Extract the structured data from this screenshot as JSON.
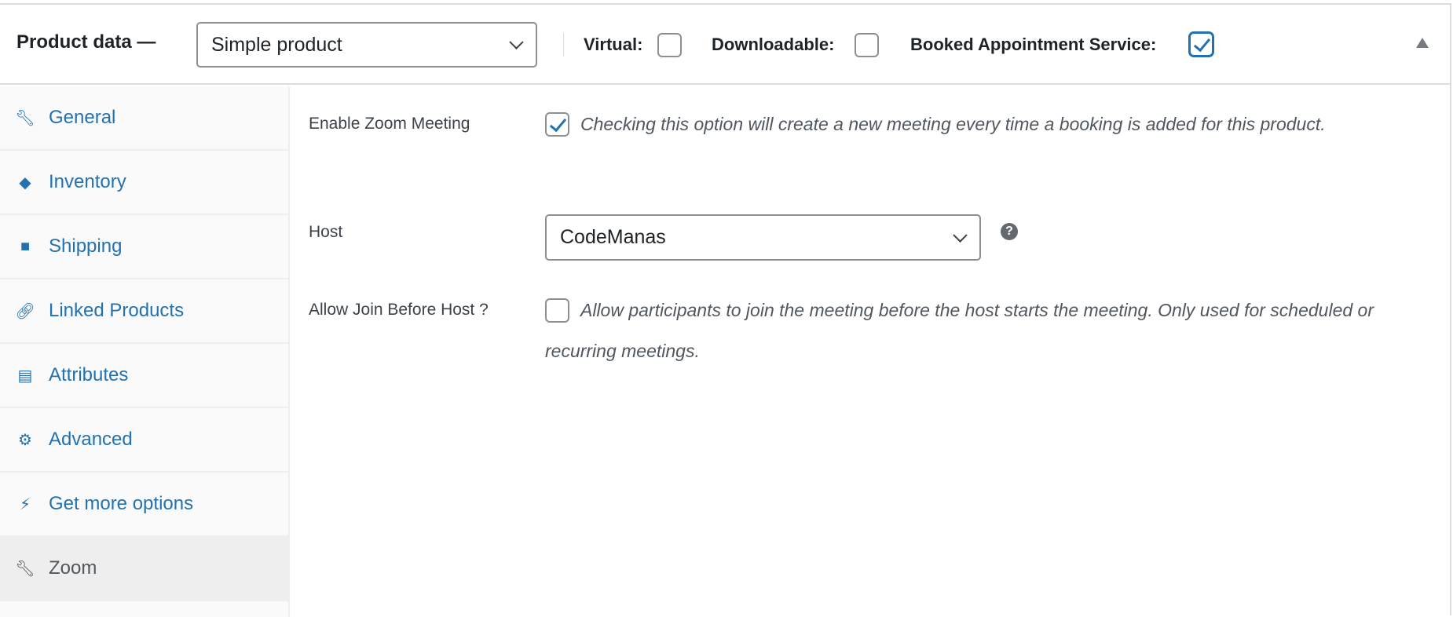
{
  "header": {
    "title": "Product data —",
    "product_type": "Simple product",
    "options": [
      {
        "label": "Virtual:",
        "checked": false
      },
      {
        "label": "Downloadable:",
        "checked": false
      },
      {
        "label": "Booked Appointment Service:",
        "checked": true
      }
    ]
  },
  "sidebar": {
    "items": [
      {
        "label": "General",
        "icon": "wrench-icon"
      },
      {
        "label": "Inventory",
        "icon": "tag-icon"
      },
      {
        "label": "Shipping",
        "icon": "truck-icon"
      },
      {
        "label": "Linked Products",
        "icon": "link-icon"
      },
      {
        "label": "Attributes",
        "icon": "list-icon"
      },
      {
        "label": "Advanced",
        "icon": "gear-icon"
      },
      {
        "label": "Get more options",
        "icon": "plugin-icon"
      },
      {
        "label": "Zoom",
        "icon": "wrench-icon",
        "active": true
      }
    ]
  },
  "fields": {
    "enable_zoom": {
      "label": "Enable Zoom Meeting",
      "checked": true,
      "description": "Checking this option will create a new meeting every time a booking is added for this product."
    },
    "host": {
      "label": "Host",
      "value": "CodeManas",
      "help": "?"
    },
    "join_before_host": {
      "label": "Allow Join Before Host ?",
      "checked": false,
      "description": "Allow participants to join the meeting before the host starts the meeting. Only used for scheduled or recurring meetings."
    }
  },
  "colors": {
    "link": "#2271b1",
    "border": "#dcdcde"
  }
}
